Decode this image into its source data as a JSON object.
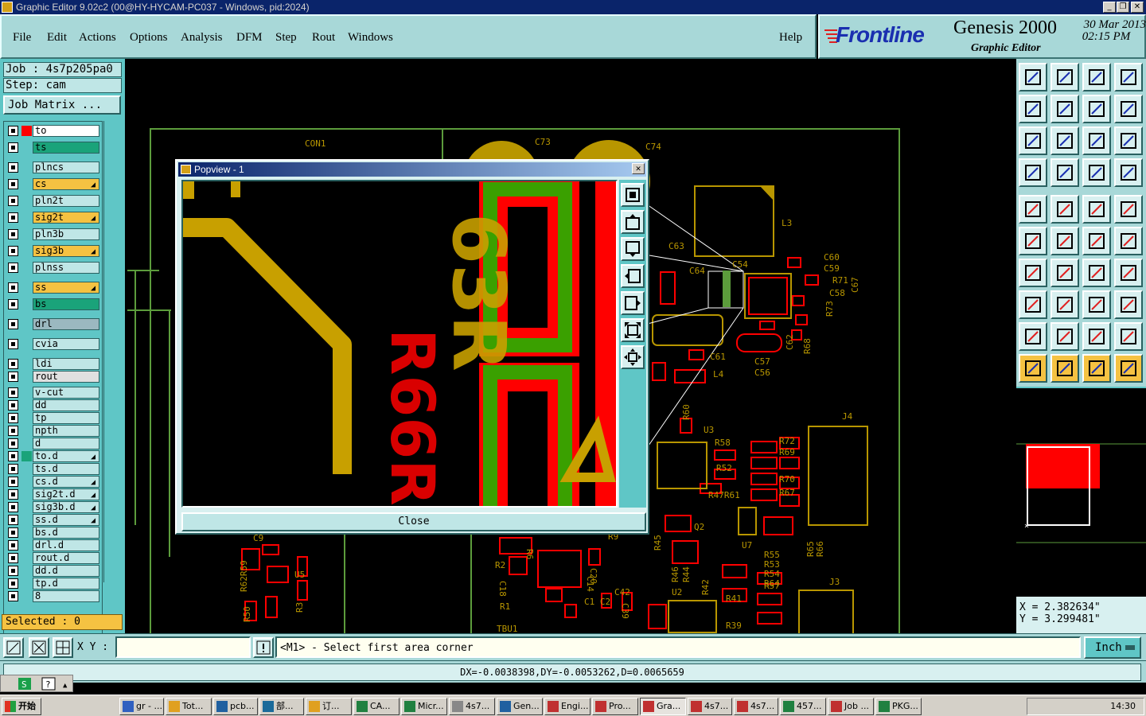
{
  "window": {
    "title": "Graphic Editor 9.02c2 (00@HY-HYCAM-PC037 - Windows, pid:2024)",
    "controls": [
      "_",
      "❐",
      "✕"
    ]
  },
  "menu": [
    "File",
    "Edit",
    "Actions",
    "Options",
    "Analysis",
    "DFM",
    "Step",
    "Rout",
    "Windows"
  ],
  "help_label": "Help",
  "brand": {
    "logo": "Frontline",
    "product": "Genesis 2000",
    "subtitle": "Graphic Editor",
    "date": "30 Mar 2013",
    "time": "02:15 PM"
  },
  "job": {
    "job_label": "Job : 4s7p205pa0",
    "step_label": "Step: cam",
    "matrix_button": "Job Matrix ..."
  },
  "layers": [
    {
      "name": "to",
      "color": "#ffffff",
      "affected": "#ff0000",
      "work": true
    },
    {
      "name": "ts",
      "color": "#1aa37a"
    },
    {
      "name": "plncs",
      "color": "#bfe6e6"
    },
    {
      "name": "cs",
      "color": "#f5c242",
      "feat": true
    },
    {
      "name": "pln2t",
      "color": "#bfe6e6"
    },
    {
      "name": "sig2t",
      "color": "#f5c242",
      "feat": true
    },
    {
      "name": "pln3b",
      "color": "#bfe6e6"
    },
    {
      "name": "sig3b",
      "color": "#f5c242",
      "feat": true
    },
    {
      "name": "plnss",
      "color": "#bfe6e6"
    },
    {
      "name": "ss",
      "color": "#f5c242",
      "feat": true
    },
    {
      "name": "bs",
      "color": "#1aa37a"
    },
    {
      "name": "drl",
      "color": "#9bb8c0"
    },
    {
      "name": "cvia",
      "color": "#bfe6e6"
    },
    {
      "name": "ldi",
      "color": "#bfe6e6"
    },
    {
      "name": "rout",
      "color": "#e0e0e0"
    },
    {
      "name": "v-cut",
      "color": "#bfe6e6"
    },
    {
      "name": "dd",
      "color": "#bfe6e6"
    },
    {
      "name": "tp",
      "color": "#bfe6e6"
    },
    {
      "name": "npth",
      "color": "#bfe6e6"
    },
    {
      "name": "d",
      "color": "#bfe6e6"
    },
    {
      "name": "to.d",
      "color": "#bfe6e6",
      "feat": true,
      "affected": "#1aa37a"
    },
    {
      "name": "ts.d",
      "color": "#bfe6e6"
    },
    {
      "name": "cs.d",
      "color": "#bfe6e6",
      "feat": true
    },
    {
      "name": "sig2t.d",
      "color": "#bfe6e6",
      "feat": true
    },
    {
      "name": "sig3b.d",
      "color": "#bfe6e6",
      "feat": true
    },
    {
      "name": "ss.d",
      "color": "#bfe6e6",
      "feat": true
    },
    {
      "name": "bs.d",
      "color": "#bfe6e6"
    },
    {
      "name": "drl.d",
      "color": "#bfe6e6"
    },
    {
      "name": "rout.d",
      "color": "#bfe6e6"
    },
    {
      "name": "dd.d",
      "color": "#bfe6e6"
    },
    {
      "name": "tp.d",
      "color": "#bfe6e6"
    },
    {
      "name": "8",
      "color": "#bfe6e6"
    }
  ],
  "selected_label": "Selected : 0",
  "canvas_labels": {
    "con1": "CON1",
    "c73": "C73",
    "c74": "C74",
    "l3": "L3",
    "c63": "C63",
    "c64": "C64",
    "c54": "C54",
    "c60": "C60",
    "c59": "C59",
    "r71": "R71",
    "c58": "C58",
    "c67": "C67",
    "r73": "R73",
    "c62": "C62",
    "r68": "R68",
    "c57": "C57",
    "c56": "C56",
    "c61": "C61",
    "l4": "L4",
    "r60": "R60",
    "u3": "U3",
    "r58": "R58",
    "r52": "R52",
    "r47r61": "R47R61",
    "r72": "R72",
    "r69": "R69",
    "r70": "R70",
    "r67": "R67",
    "j4": "J4",
    "q2": "Q2",
    "u7": "U7",
    "r45": "R45",
    "r44": "R44",
    "r46": "R46",
    "r42": "R42",
    "u2": "U2",
    "r41": "R41",
    "r39": "R39",
    "r55": "R55",
    "r53": "R53",
    "r54": "R54",
    "r64": "R64",
    "r57": "R57",
    "r65": "R65",
    "r66": "R66",
    "j3": "J3",
    "u5": "U5",
    "r3": "R3",
    "c9": "C9",
    "r62r59": "R62R59",
    "r50": "R50",
    "c20": "C20",
    "c14": "C14",
    "c1c2": "C1 C2",
    "c42": "C42",
    "c39": "C39",
    "r2": "R2",
    "c18": "C18",
    "r1": "R1",
    "tbu1": "TBU1",
    "r9": "R9",
    "r6": "R6"
  },
  "coords": {
    "x": "X = 2.382634\"",
    "y": "Y = 3.299481\""
  },
  "command": {
    "xy_label": "X Y :",
    "xy_value": "",
    "message": "<M1> - Select first area corner",
    "unit": "Inch"
  },
  "status": "DX=-0.0038398,DY=-0.0053262,D=0.0065659",
  "popview": {
    "title": "Popview - 1",
    "close_button": "Close",
    "silk_text_a": "63R",
    "silk_text_b": "R66R"
  },
  "taskbar": {
    "start": "开始",
    "items": [
      "gr - ...",
      "Tot...",
      "pcb...",
      "部...",
      "订...",
      "CA...",
      "Micr...",
      "4s7...",
      "Gen...",
      "Engi...",
      "Pro...",
      "Gra...",
      "4s7...",
      "4s7...",
      "457...",
      "Job ...",
      "PKG..."
    ],
    "active_index": 11,
    "clock": "14:30"
  },
  "colors": {
    "silk_yellow": "#c8a000",
    "copper_red": "#ff0000",
    "mask_green": "#3aa000",
    "outline_green": "#5c9c3c",
    "panel_teal": "#a8d8d8"
  }
}
